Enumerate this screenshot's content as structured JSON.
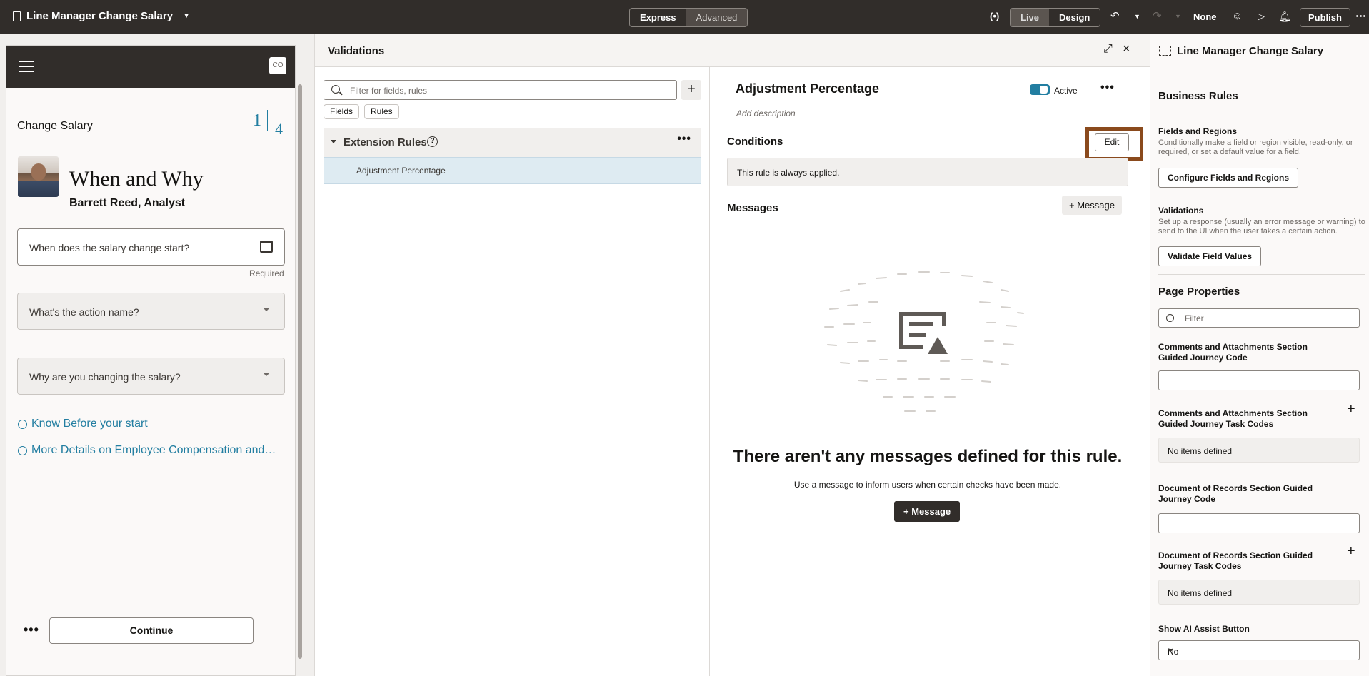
{
  "topbar": {
    "title": "Line Manager Change Salary",
    "mode_express": "Express",
    "mode_advanced": "Advanced",
    "live": "Live",
    "design": "Design",
    "none": "None",
    "publish": "Publish"
  },
  "preview": {
    "page_title": "Change Salary",
    "step_current": "1",
    "step_total": "4",
    "avatar_badge": "CO",
    "heading": "When and Why",
    "person": "Barrett Reed, Analyst",
    "date_placeholder": "When does the salary change start?",
    "required": "Required",
    "action_placeholder": "What's the action name?",
    "reason_placeholder": "Why are you changing the salary?",
    "link1": "Know Before your start",
    "link2": "More Details on Employee Compensation and…",
    "continue": "Continue"
  },
  "validations": {
    "title": "Validations",
    "search_placeholder": "Filter for fields, rules",
    "chip_fields": "Fields",
    "chip_rules": "Rules",
    "group_label": "Extension Rules",
    "rule_item": "Adjustment Percentage",
    "detail": {
      "title": "Adjustment Percentage",
      "active": "Active",
      "add_description": "Add description",
      "conditions": "Conditions",
      "edit": "Edit",
      "condition_text": "This rule is always applied.",
      "messages": "Messages",
      "message_btn": "Message",
      "empty_title": "There aren't any messages defined for this rule.",
      "empty_sub": "Use a message to inform users when certain checks have been made."
    }
  },
  "props": {
    "title": "Line Manager Change Salary",
    "business_rules": "Business Rules",
    "fields_regions": "Fields and Regions",
    "fields_regions_desc": "Conditionally make a field or region visible, read-only, or required, or set a default value for a field.",
    "configure_btn": "Configure Fields and Regions",
    "validations": "Validations",
    "validations_desc": "Set up a response (usually an error message or warning) to send to the UI when the user takes a certain action.",
    "validate_btn": "Validate Field Values",
    "page_properties": "Page Properties",
    "filter_placeholder": "Filter",
    "p1_label": "Comments and Attachments Section Guided Journey Code",
    "p2_label": "Comments and Attachments Section Guided Journey Task Codes",
    "p2_empty": "No items defined",
    "p3_label": "Document of Records Section Guided Journey Code",
    "p4_label": "Document of Records Section Guided Journey Task Codes",
    "p4_empty": "No items defined",
    "p5_label": "Show AI Assist Button",
    "p5_value": "No"
  }
}
